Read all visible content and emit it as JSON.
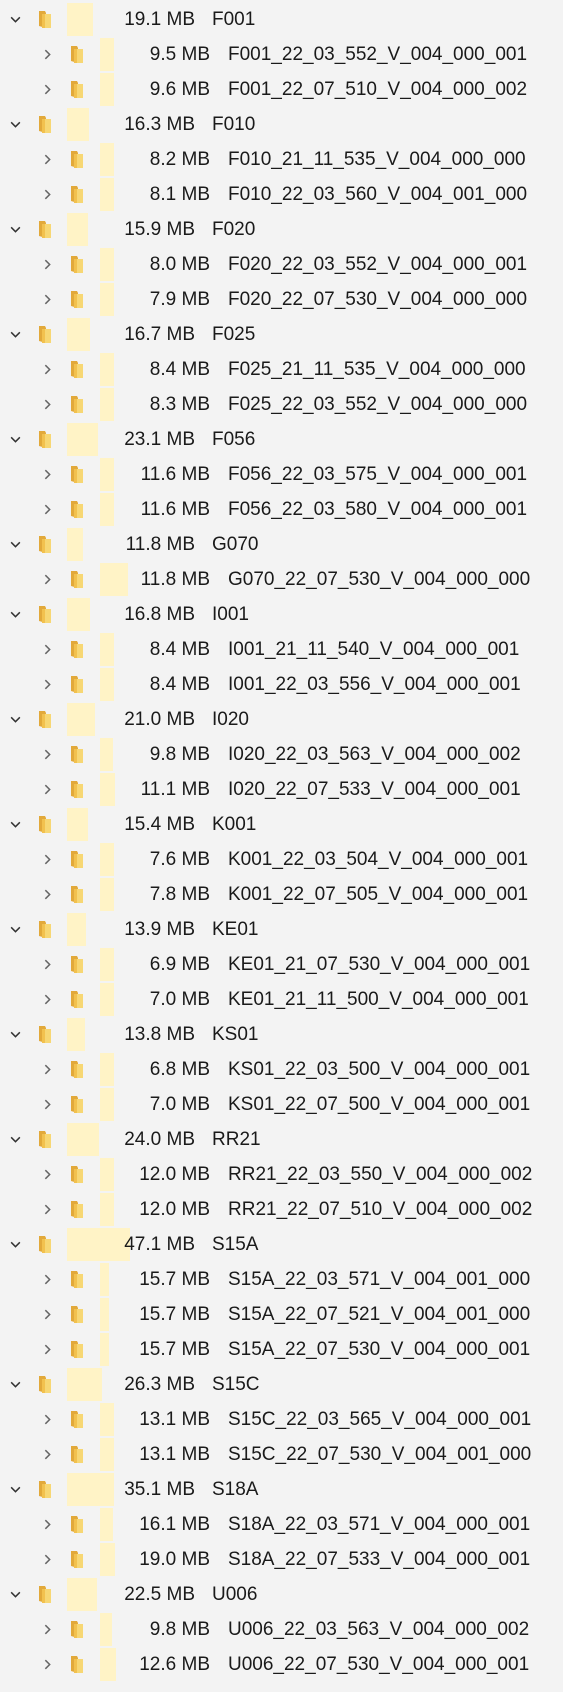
{
  "icons": {
    "expanded": "chevron-down-icon",
    "collapsed": "chevron-right-icon",
    "folder": "folder-icon"
  },
  "colors": {
    "size_bar": "#fff3c6",
    "folder": "#f2c14e",
    "background": "#f3f3f3"
  },
  "groups": [
    {
      "size": "19.1 MB",
      "name": "F001",
      "share": 0.41,
      "children": [
        {
          "size": "9.5 MB",
          "name": "F001_22_03_552_V_004_000_001",
          "share": 0.5
        },
        {
          "size": "9.6 MB",
          "name": "F001_22_07_510_V_004_000_002",
          "share": 0.5
        }
      ]
    },
    {
      "size": "16.3 MB",
      "name": "F010",
      "share": 0.35,
      "children": [
        {
          "size": "8.2 MB",
          "name": "F010_21_11_535_V_004_000_000",
          "share": 0.5
        },
        {
          "size": "8.1 MB",
          "name": "F010_22_03_560_V_004_001_000",
          "share": 0.5
        }
      ]
    },
    {
      "size": "15.9 MB",
      "name": "F020",
      "share": 0.34,
      "children": [
        {
          "size": "8.0 MB",
          "name": "F020_22_03_552_V_004_000_001",
          "share": 0.5
        },
        {
          "size": "7.9 MB",
          "name": "F020_22_07_530_V_004_000_000",
          "share": 0.5
        }
      ]
    },
    {
      "size": "16.7 MB",
      "name": "F025",
      "share": 0.36,
      "children": [
        {
          "size": "8.4 MB",
          "name": "F025_21_11_535_V_004_000_000",
          "share": 0.5
        },
        {
          "size": "8.3 MB",
          "name": "F025_22_03_552_V_004_000_000",
          "share": 0.5
        }
      ]
    },
    {
      "size": "23.1 MB",
      "name": "F056",
      "share": 0.49,
      "children": [
        {
          "size": "11.6 MB",
          "name": "F056_22_03_575_V_004_000_001",
          "share": 0.5
        },
        {
          "size": "11.6 MB",
          "name": "F056_22_03_580_V_004_000_001",
          "share": 0.5
        }
      ]
    },
    {
      "size": "11.8 MB",
      "name": "G070",
      "share": 0.25,
      "children": [
        {
          "size": "11.8 MB",
          "name": "G070_22_07_530_V_004_000_000",
          "share": 1.0
        }
      ]
    },
    {
      "size": "16.8 MB",
      "name": "I001",
      "share": 0.36,
      "children": [
        {
          "size": "8.4 MB",
          "name": "I001_21_11_540_V_004_000_001",
          "share": 0.5
        },
        {
          "size": "8.4 MB",
          "name": "I001_22_03_556_V_004_000_001",
          "share": 0.5
        }
      ]
    },
    {
      "size": "21.0 MB",
      "name": "I020",
      "share": 0.45,
      "children": [
        {
          "size": "9.8 MB",
          "name": "I020_22_03_563_V_004_000_002",
          "share": 0.47
        },
        {
          "size": "11.1 MB",
          "name": "I020_22_07_533_V_004_000_001",
          "share": 0.53
        }
      ]
    },
    {
      "size": "15.4 MB",
      "name": "K001",
      "share": 0.33,
      "children": [
        {
          "size": "7.6 MB",
          "name": "K001_22_03_504_V_004_000_001",
          "share": 0.49
        },
        {
          "size": "7.8 MB",
          "name": "K001_22_07_505_V_004_000_001",
          "share": 0.51
        }
      ]
    },
    {
      "size": "13.9 MB",
      "name": "KE01",
      "share": 0.3,
      "children": [
        {
          "size": "6.9 MB",
          "name": "KE01_21_07_530_V_004_000_001",
          "share": 0.5
        },
        {
          "size": "7.0 MB",
          "name": "KE01_21_11_500_V_004_000_001",
          "share": 0.5
        }
      ]
    },
    {
      "size": "13.8 MB",
      "name": "KS01",
      "share": 0.29,
      "children": [
        {
          "size": "6.8 MB",
          "name": "KS01_22_03_500_V_004_000_001",
          "share": 0.49
        },
        {
          "size": "7.0 MB",
          "name": "KS01_22_07_500_V_004_000_001",
          "share": 0.51
        }
      ]
    },
    {
      "size": "24.0 MB",
      "name": "RR21",
      "share": 0.51,
      "children": [
        {
          "size": "12.0 MB",
          "name": "RR21_22_03_550_V_004_000_002",
          "share": 0.5
        },
        {
          "size": "12.0 MB",
          "name": "RR21_22_07_510_V_004_000_002",
          "share": 0.5
        }
      ]
    },
    {
      "size": "47.1 MB",
      "name": "S15A",
      "share": 1.0,
      "children": [
        {
          "size": "15.7 MB",
          "name": "S15A_22_03_571_V_004_001_000",
          "share": 0.33
        },
        {
          "size": "15.7 MB",
          "name": "S15A_22_07_521_V_004_001_000",
          "share": 0.33
        },
        {
          "size": "15.7 MB",
          "name": "S15A_22_07_530_V_004_000_001",
          "share": 0.33
        }
      ]
    },
    {
      "size": "26.3 MB",
      "name": "S15C",
      "share": 0.56,
      "children": [
        {
          "size": "13.1 MB",
          "name": "S15C_22_03_565_V_004_000_001",
          "share": 0.5
        },
        {
          "size": "13.1 MB",
          "name": "S15C_22_07_530_V_004_001_000",
          "share": 0.5
        }
      ]
    },
    {
      "size": "35.1 MB",
      "name": "S18A",
      "share": 0.75,
      "children": [
        {
          "size": "16.1 MB",
          "name": "S18A_22_03_571_V_004_000_001",
          "share": 0.46
        },
        {
          "size": "19.0 MB",
          "name": "S18A_22_07_533_V_004_000_001",
          "share": 0.54
        }
      ]
    },
    {
      "size": "22.5 MB",
      "name": "U006",
      "share": 0.48,
      "children": [
        {
          "size": "9.8 MB",
          "name": "U006_22_03_563_V_004_000_002",
          "share": 0.44
        },
        {
          "size": "12.6 MB",
          "name": "U006_22_07_530_V_004_000_001",
          "share": 0.56
        }
      ]
    }
  ]
}
